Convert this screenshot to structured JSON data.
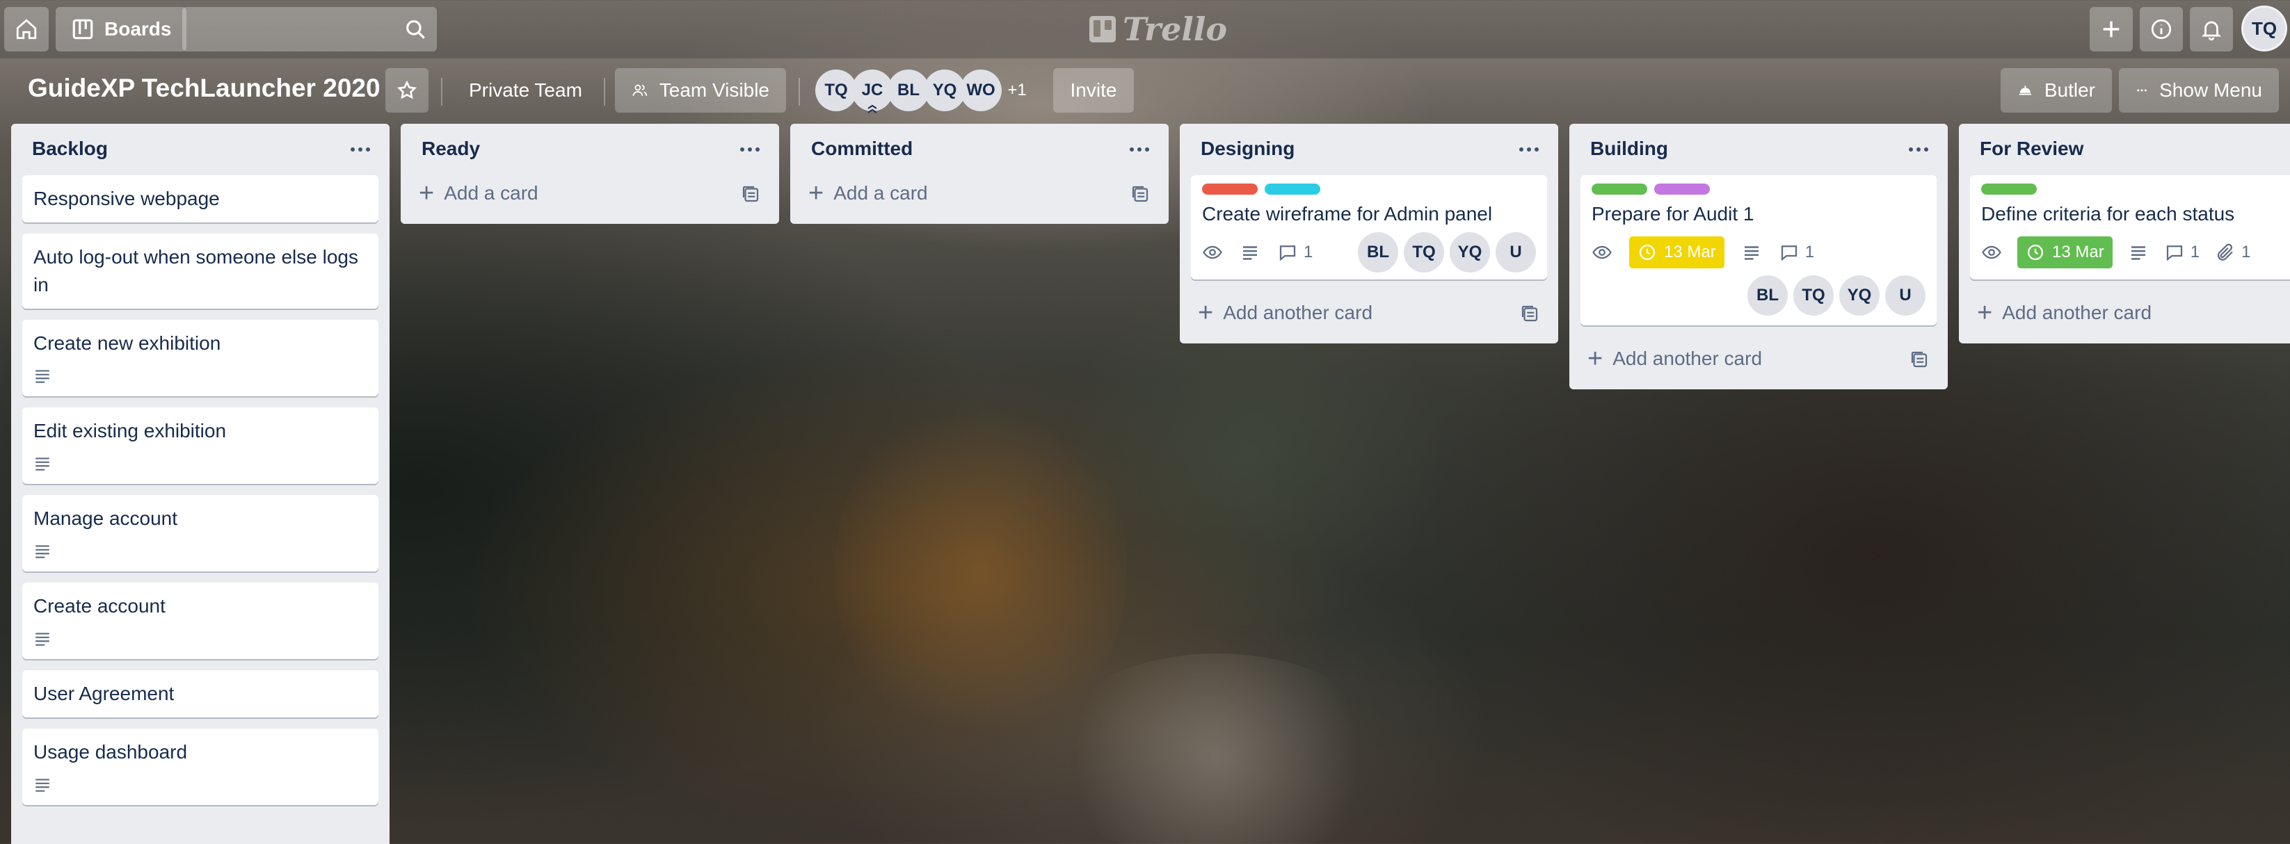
{
  "header": {
    "home_icon": "home-icon",
    "boards_label": "Boards",
    "search_placeholder": "",
    "logo_text": "Trello",
    "user_initials": "TQ"
  },
  "board": {
    "title": "GuideXP TechLauncher 2020",
    "team_label": "Private Team",
    "visibility_label": "Team Visible",
    "members": [
      "TQ",
      "JC",
      "BL",
      "YQ",
      "WO"
    ],
    "members_more": "+1",
    "invite_label": "Invite",
    "butler_label": "Butler",
    "menu_label": "Show Menu"
  },
  "colors": {
    "label_red": "#eb5a46",
    "label_cyan": "#29cce5",
    "label_green": "#61bd4f",
    "label_purple": "#c377e0",
    "due_yellow": "#f2d600",
    "due_green": "#61bd4f"
  },
  "lists": [
    {
      "title": "Backlog",
      "cards": [
        {
          "title": "Responsive webpage"
        },
        {
          "title": "Auto log-out when someone else logs in"
        },
        {
          "title": "Create new exhibition"
        },
        {
          "title": "Edit existing exhibition"
        },
        {
          "title": "Manage account"
        },
        {
          "title": "Create account"
        },
        {
          "title": "User Agreement"
        },
        {
          "title": "Usage dashboard"
        }
      ]
    },
    {
      "title": "Ready",
      "add_label": "Add a card"
    },
    {
      "title": "Committed",
      "add_label": "Add a card"
    },
    {
      "title": "Designing",
      "add_label": "Add another card",
      "cards": [
        {
          "title": "Create wireframe for Admin panel",
          "comments": "1",
          "members": [
            "BL",
            "TQ",
            "YQ",
            "U"
          ]
        }
      ]
    },
    {
      "title": "Building",
      "add_label": "Add another card",
      "cards": [
        {
          "title": "Prepare for Audit 1",
          "due": "13 Mar",
          "comments": "1",
          "members": [
            "BL",
            "TQ",
            "YQ",
            "U"
          ]
        }
      ]
    },
    {
      "title": "For Review",
      "add_label": "Add another card",
      "cards": [
        {
          "title": "Define criteria for each status",
          "due": "13 Mar",
          "comments": "1",
          "attachments": "1"
        }
      ]
    }
  ]
}
